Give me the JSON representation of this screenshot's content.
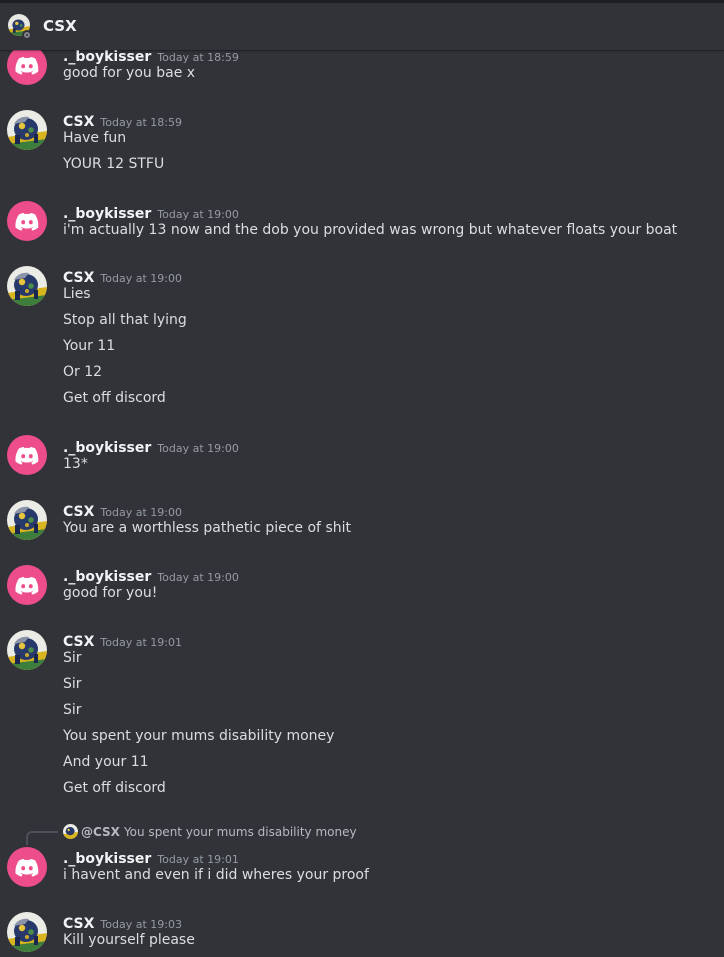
{
  "channel": {
    "title": "CSX",
    "status": "offline"
  },
  "icons": {
    "discord_default_avatar": "discord-logo-icon",
    "csx_avatar": "csx-avatar-image"
  },
  "colors": {
    "background": "#313338",
    "discord_avatar_pink": "#ed4d8a",
    "author": "#f2f3f5",
    "timestamp": "#949ba4",
    "message_text": "#dbdee1"
  },
  "messages": [
    {
      "author": "._boykisser",
      "time": "Today at 18:59",
      "lines": [
        "good for you bae x"
      ]
    },
    {
      "author": "CSX",
      "time": "Today at 18:59",
      "lines": [
        "Have fun",
        "YOUR 12 STFU"
      ]
    },
    {
      "author": "._boykisser",
      "time": "Today at 19:00",
      "lines": [
        "i'm actually 13 now and the dob you provided was wrong but whatever floats your boat"
      ]
    },
    {
      "author": "CSX",
      "time": "Today at 19:00",
      "lines": [
        "Lies",
        "Stop all that lying",
        "Your 11",
        "Or 12",
        "Get off discord"
      ]
    },
    {
      "author": "._boykisser",
      "time": "Today at 19:00",
      "lines": [
        "13*"
      ]
    },
    {
      "author": "CSX",
      "time": "Today at 19:00",
      "lines": [
        "You are a worthless pathetic piece of shit"
      ]
    },
    {
      "author": "._boykisser",
      "time": "Today at 19:00",
      "lines": [
        "good for you!"
      ]
    },
    {
      "author": "CSX",
      "time": "Today at 19:01",
      "lines": [
        "Sir",
        "Sir",
        "Sir",
        "You spent your mums disability money",
        "And your 11",
        "Get off discord"
      ]
    },
    {
      "author": "._boykisser",
      "time": "Today at 19:01",
      "reply": {
        "author": "@CSX",
        "text": "You spent your mums disability money"
      },
      "lines": [
        "i havent and even if i did wheres your proof"
      ]
    },
    {
      "author": "CSX",
      "time": "Today at 19:03",
      "lines": [
        "Kill yourself please"
      ]
    }
  ]
}
